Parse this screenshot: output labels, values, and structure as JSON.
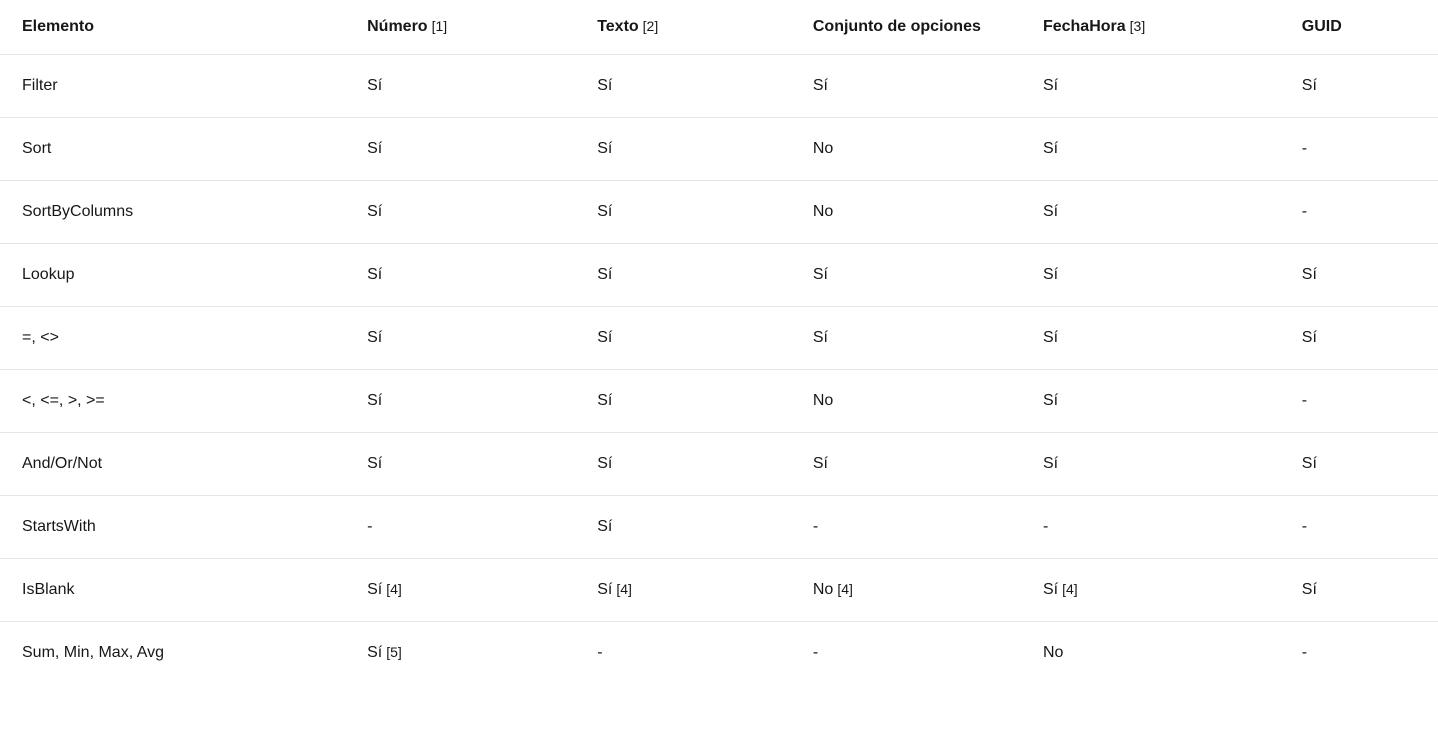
{
  "table": {
    "headers": [
      {
        "label": "Elemento",
        "note": ""
      },
      {
        "label": "Número",
        "note": "[1]"
      },
      {
        "label": "Texto",
        "note": "[2]"
      },
      {
        "label": "Conjunto de opciones",
        "note": ""
      },
      {
        "label": "FechaHora",
        "note": "[3]"
      },
      {
        "label": "GUID",
        "note": ""
      }
    ],
    "rows": [
      {
        "cells": [
          {
            "value": "Filter",
            "note": ""
          },
          {
            "value": "Sí",
            "note": ""
          },
          {
            "value": "Sí",
            "note": ""
          },
          {
            "value": "Sí",
            "note": ""
          },
          {
            "value": "Sí",
            "note": ""
          },
          {
            "value": "Sí",
            "note": ""
          }
        ]
      },
      {
        "cells": [
          {
            "value": "Sort",
            "note": ""
          },
          {
            "value": "Sí",
            "note": ""
          },
          {
            "value": "Sí",
            "note": ""
          },
          {
            "value": "No",
            "note": ""
          },
          {
            "value": "Sí",
            "note": ""
          },
          {
            "value": "-",
            "note": ""
          }
        ]
      },
      {
        "cells": [
          {
            "value": "SortByColumns",
            "note": ""
          },
          {
            "value": "Sí",
            "note": ""
          },
          {
            "value": "Sí",
            "note": ""
          },
          {
            "value": "No",
            "note": ""
          },
          {
            "value": "Sí",
            "note": ""
          },
          {
            "value": "-",
            "note": ""
          }
        ]
      },
      {
        "cells": [
          {
            "value": "Lookup",
            "note": ""
          },
          {
            "value": "Sí",
            "note": ""
          },
          {
            "value": "Sí",
            "note": ""
          },
          {
            "value": "Sí",
            "note": ""
          },
          {
            "value": "Sí",
            "note": ""
          },
          {
            "value": "Sí",
            "note": ""
          }
        ]
      },
      {
        "cells": [
          {
            "value": "=, <>",
            "note": ""
          },
          {
            "value": "Sí",
            "note": ""
          },
          {
            "value": "Sí",
            "note": ""
          },
          {
            "value": "Sí",
            "note": ""
          },
          {
            "value": "Sí",
            "note": ""
          },
          {
            "value": "Sí",
            "note": ""
          }
        ]
      },
      {
        "cells": [
          {
            "value": "<, <=, >, >=",
            "note": ""
          },
          {
            "value": "Sí",
            "note": ""
          },
          {
            "value": "Sí",
            "note": ""
          },
          {
            "value": "No",
            "note": ""
          },
          {
            "value": "Sí",
            "note": ""
          },
          {
            "value": "-",
            "note": ""
          }
        ]
      },
      {
        "cells": [
          {
            "value": "And/Or/Not",
            "note": ""
          },
          {
            "value": "Sí",
            "note": ""
          },
          {
            "value": "Sí",
            "note": ""
          },
          {
            "value": "Sí",
            "note": ""
          },
          {
            "value": "Sí",
            "note": ""
          },
          {
            "value": "Sí",
            "note": ""
          }
        ]
      },
      {
        "cells": [
          {
            "value": "StartsWith",
            "note": ""
          },
          {
            "value": "-",
            "note": ""
          },
          {
            "value": "Sí",
            "note": ""
          },
          {
            "value": "-",
            "note": ""
          },
          {
            "value": "-",
            "note": ""
          },
          {
            "value": "-",
            "note": ""
          }
        ]
      },
      {
        "cells": [
          {
            "value": "IsBlank",
            "note": ""
          },
          {
            "value": "Sí",
            "note": "[4]"
          },
          {
            "value": "Sí",
            "note": "[4]"
          },
          {
            "value": "No",
            "note": "[4]"
          },
          {
            "value": "Sí",
            "note": "[4]"
          },
          {
            "value": "Sí",
            "note": ""
          }
        ]
      },
      {
        "cells": [
          {
            "value": "Sum, Min, Max, Avg",
            "note": ""
          },
          {
            "value": "Sí",
            "note": "[5]"
          },
          {
            "value": "-",
            "note": ""
          },
          {
            "value": "-",
            "note": ""
          },
          {
            "value": "No",
            "note": ""
          },
          {
            "value": "-",
            "note": ""
          }
        ]
      }
    ]
  }
}
